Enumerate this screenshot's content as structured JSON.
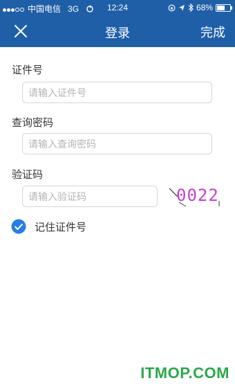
{
  "status_bar": {
    "carrier": "中国电信",
    "network": "3G",
    "time": "12:24",
    "battery": "68%",
    "battery_level": 0.68
  },
  "nav": {
    "title": "登录",
    "done": "完成"
  },
  "form": {
    "id_label": "证件号",
    "id_placeholder": "请输入证件号",
    "password_label": "查询密码",
    "password_placeholder": "请输入查询密码",
    "captcha_label": "验证码",
    "captcha_placeholder": "请输入验证码",
    "captcha_text": "0022",
    "remember_label": "记住证件号",
    "remember_checked": true
  },
  "colors": {
    "brand": "#1f5fa8",
    "check": "#2a7de1",
    "captcha_text": "#c43fd0"
  },
  "watermark": "ITMOP.COM"
}
